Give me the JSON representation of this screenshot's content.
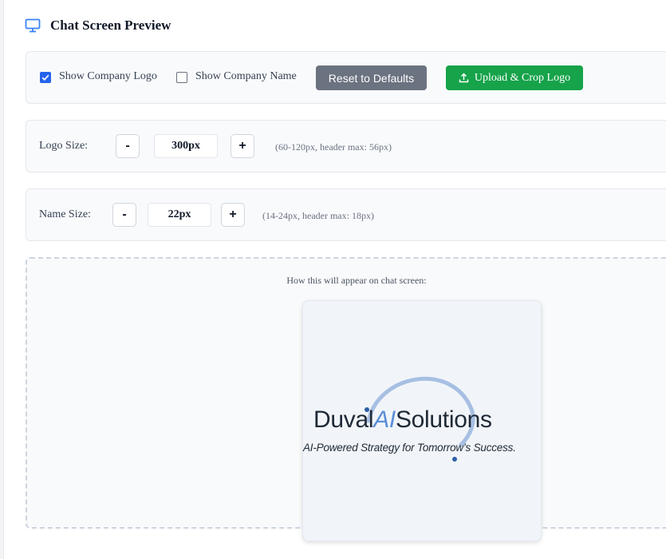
{
  "header": {
    "title": "Chat Screen Preview",
    "icon": "monitor-icon",
    "accent_color": "#3b82f6"
  },
  "toolbar": {
    "show_logo": {
      "label": "Show Company Logo",
      "checked": true
    },
    "show_name": {
      "label": "Show Company Name",
      "checked": false
    },
    "reset_label": "Reset to Defaults",
    "upload_label": "Upload & Crop Logo",
    "upload_icon": "upload-icon"
  },
  "logo_size": {
    "label": "Logo Size:",
    "decrement": "-",
    "value": "300px",
    "increment": "+",
    "hint": "(60-120px, header max: 56px)"
  },
  "name_size": {
    "label": "Name Size:",
    "decrement": "-",
    "value": "22px",
    "increment": "+",
    "hint": "(14-24px, header max: 18px)"
  },
  "preview": {
    "caption": "How this will appear on chat screen:",
    "logo": {
      "name_start": "Duval",
      "name_ai": "AI",
      "name_end": "Solutions",
      "tagline": "AI-Powered Strategy for Tomorrow’s Success."
    }
  },
  "colors": {
    "gray_button": "#6b7280",
    "green_button": "#16a34a",
    "checkbox": "#2563eb"
  }
}
